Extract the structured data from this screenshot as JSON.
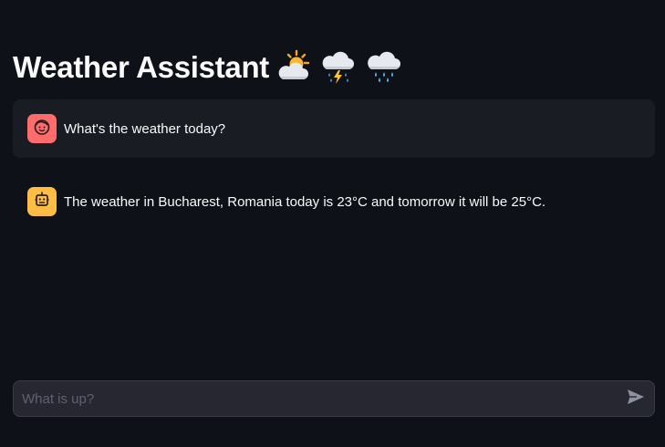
{
  "header": {
    "title": "Weather Assistant",
    "icons": [
      "sun-behind-cloud-icon",
      "thunder-rain-cloud-icon",
      "rain-cloud-icon"
    ]
  },
  "messages": [
    {
      "role": "user",
      "avatar_icon": "user-face-icon",
      "text": "What's the weather today?"
    },
    {
      "role": "assistant",
      "avatar_icon": "robot-icon",
      "text": "The weather in Bucharest, Romania today is 23°C and tomorrow it will be 25°C."
    }
  ],
  "chat_input": {
    "placeholder": "What is up?",
    "value": "",
    "send_icon": "send-icon"
  },
  "colors": {
    "background": "#0e1117",
    "user_message_bg": "#1a1c24",
    "user_avatar": "#ff6c6c",
    "assistant_avatar": "#ffbd45",
    "input_bg": "#262730"
  }
}
